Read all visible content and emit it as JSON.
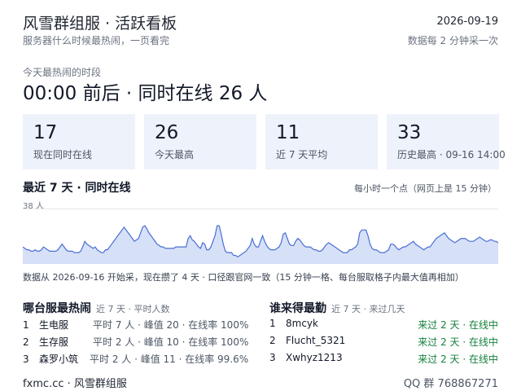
{
  "header": {
    "title": "风雪群组服 · 活跃看板",
    "subtitle": "服务器什么时候最热闹，一页看完",
    "date": "2026-09-19",
    "update_note": "数据每 2 分钟采一次"
  },
  "peak": {
    "label": "今天最热闹的时段",
    "value": "00:00 前后 · 同时在线 26 人"
  },
  "stats": [
    {
      "number": "17",
      "label": "现在同时在线"
    },
    {
      "number": "26",
      "label": "今天最高"
    },
    {
      "number": "11",
      "label": "近 7 天平均"
    },
    {
      "number": "33",
      "label": "历史最高 · 09-16 14:00"
    }
  ],
  "chart": {
    "title": "最近 7 天 · 同时在线",
    "note": "每小时一个点（网页上是 15 分钟）",
    "ymax_label": "38 人",
    "line_color": "#4a6fd4",
    "fill_color": "#d6e0f7"
  },
  "chart_data": {
    "type": "area",
    "ylim": [
      0,
      38
    ],
    "values": [
      12,
      11,
      10,
      10,
      9,
      9,
      10,
      9,
      9,
      10,
      12,
      11,
      10,
      9,
      9,
      9,
      9,
      10,
      12,
      14,
      12,
      10,
      9,
      9,
      9,
      8,
      8,
      8,
      9,
      12,
      16,
      14,
      13,
      12,
      11,
      12,
      10,
      9,
      8,
      8,
      10,
      10,
      12,
      14,
      16,
      18,
      20,
      22,
      24,
      26,
      24,
      22,
      20,
      18,
      16,
      17,
      18,
      22,
      26,
      27,
      25,
      22,
      20,
      18,
      16,
      14,
      13,
      12,
      12,
      11,
      11,
      11,
      11,
      11,
      12,
      12,
      12,
      12,
      12,
      12,
      18,
      20,
      17,
      16,
      14,
      12,
      11,
      15,
      14,
      10,
      10,
      12,
      16,
      20,
      27,
      27,
      21,
      14,
      9,
      8,
      8,
      8,
      6,
      6,
      5,
      6,
      7,
      8,
      9,
      11,
      13,
      18,
      14,
      12,
      12,
      16,
      20,
      16,
      13,
      11,
      10,
      10,
      10,
      11,
      12,
      15,
      21,
      22,
      18,
      14,
      13,
      13,
      16,
      18,
      17,
      15,
      13,
      12,
      12,
      12,
      11,
      10,
      10,
      9,
      9,
      10,
      12,
      14,
      15,
      14,
      13,
      12,
      11,
      10,
      9,
      8,
      8,
      8,
      10,
      10,
      11,
      12,
      14,
      22,
      24,
      24,
      24,
      20,
      14,
      11,
      10,
      10,
      9,
      8,
      8,
      8,
      9,
      10,
      14,
      14,
      13,
      11,
      10,
      11,
      12,
      12,
      13,
      14,
      15,
      16,
      14,
      13,
      12,
      11,
      10,
      11,
      12,
      12,
      14,
      16,
      18,
      19,
      20,
      21,
      22,
      20,
      18,
      17,
      16,
      15,
      16,
      17,
      18,
      18,
      18,
      17,
      16,
      16,
      16,
      17,
      18,
      19,
      18,
      17,
      16,
      16,
      17,
      17,
      16,
      16,
      15
    ]
  },
  "footnote": "数据从 2026-09-16 开始采，现在攒了 4 天 · 口径跟官网一致（15 分钟一格、每台服取格子内最大值再相加）",
  "servers": {
    "title": "哪台服最热闹",
    "subtitle": "近 7 天 · 平时人数",
    "rows": [
      {
        "rank": "1",
        "name": "生电服",
        "detail": "平时 7 人 · 峰值 20 · 在线率 100%"
      },
      {
        "rank": "2",
        "name": "生存服",
        "detail": "平时 2 人 · 峰值 10 · 在线率 100%"
      },
      {
        "rank": "3",
        "name": "森罗小筑",
        "detail": "平时 2 人 · 峰值 11 · 在线率 99.6%"
      }
    ]
  },
  "players": {
    "title": "谁来得最勤",
    "subtitle": "近 7 天 · 来过几天",
    "rows": [
      {
        "rank": "1",
        "name": "8mcyk",
        "status": "来过 2 天 · 在线中"
      },
      {
        "rank": "2",
        "name": "Flucht_5321",
        "status": "来过 2 天 · 在线中"
      },
      {
        "rank": "3",
        "name": "Xwhyz1213",
        "status": "来过 2 天 · 在线中"
      }
    ]
  },
  "footer": {
    "site": "fxmc.cc · 风雪群组服",
    "qq": "QQ 群 768867271"
  }
}
